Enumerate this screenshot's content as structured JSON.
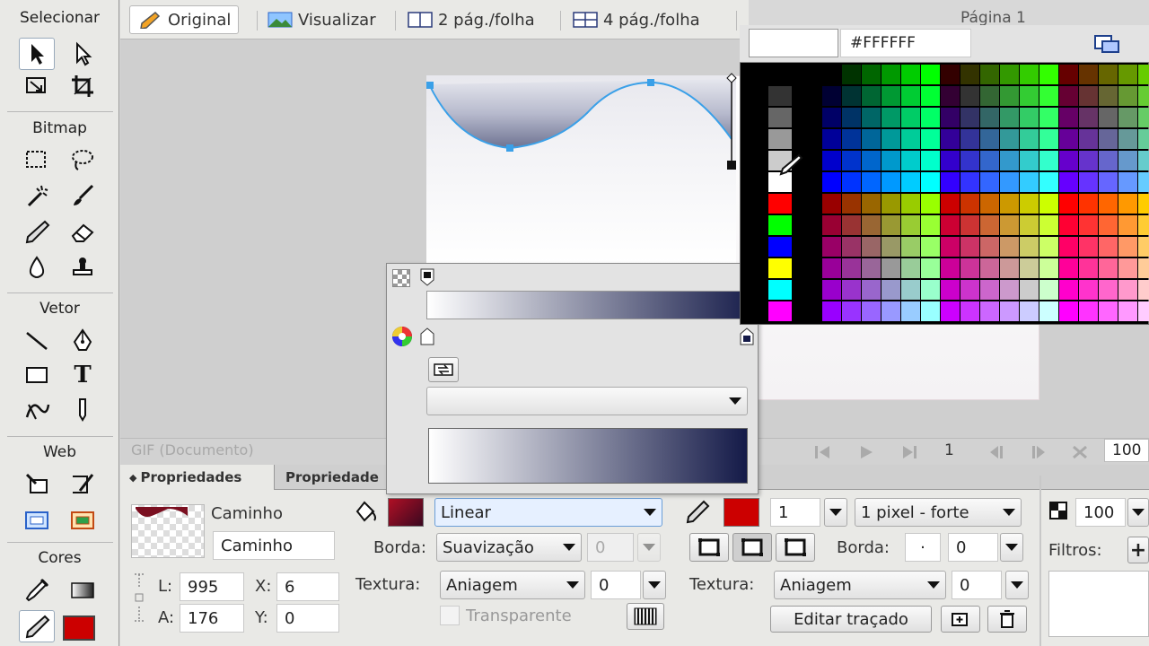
{
  "toolbar": {
    "sections": {
      "select": "Selecionar",
      "bitmap": "Bitmap",
      "vector": "Vetor",
      "web": "Web",
      "colors": "Cores"
    },
    "text_tool_glyph": "T"
  },
  "doc_tabs": {
    "original": "Original",
    "preview": "Visualizar",
    "two_up": "2 pág./folha",
    "four_up": "4 pág./folha",
    "page": "Página 1"
  },
  "status": {
    "doc_type": "GIF (Documento)",
    "frame": "1",
    "zoom": "100"
  },
  "properties": {
    "tabs": [
      "Propriedades",
      "Propriedade"
    ],
    "object_type": "Caminho",
    "object_name": "Caminho",
    "width_label": "L:",
    "width": "995",
    "height_label": "A:",
    "height": "176",
    "x_label": "X:",
    "x": "6",
    "y_label": "Y:",
    "y": "0",
    "fill": {
      "type": "Linear",
      "edge_label": "Borda:",
      "edge": "Suavização",
      "edge_amount": "0",
      "texture_label": "Textura:",
      "texture": "Aniagem",
      "texture_amount": "0",
      "transparent_label": "Transparente",
      "color": "#9b1020"
    },
    "stroke": {
      "size": "1",
      "type": "1 pixel - forte",
      "edge_label": "Borda:",
      "edge_glyph": "·",
      "edge_amount": "0",
      "texture_label": "Textura:",
      "texture": "Aniagem",
      "texture_amount": "0",
      "edit_button": "Editar traçado",
      "color": "#cc0000"
    },
    "opacity": "100",
    "filters_label": "Filtros:",
    "filters_add": "+"
  },
  "palette": {
    "hex": "#FFFFFF"
  },
  "colors": {
    "accent_blue": "#3aa0e8",
    "gradient_dark": "#141a48"
  }
}
